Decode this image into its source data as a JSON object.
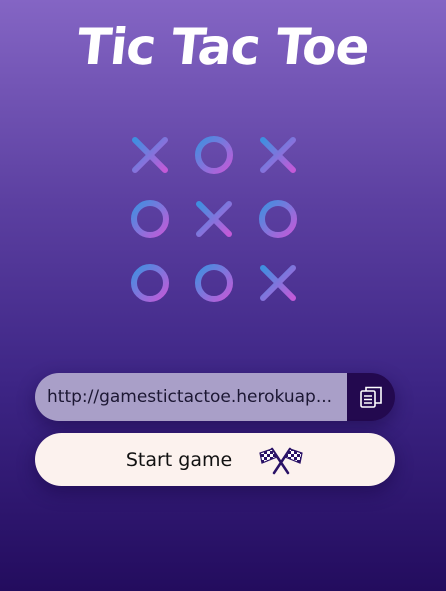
{
  "app": {
    "title": "Tic Tac Toe"
  },
  "logo": {
    "icon": "tic-tac-toe-board-icon",
    "cells": [
      "X",
      "O",
      "X",
      "O",
      "X",
      "O",
      "O",
      "O",
      "X"
    ]
  },
  "share": {
    "url": "http://gamestictactoe.herokuapp.com/...",
    "url_display": "http://gamestictactoe.herokuap...",
    "copy_icon": "copy-icon"
  },
  "actions": {
    "start_label": "Start game",
    "start_icon": "checkered-flags-icon"
  },
  "colors": {
    "background_top": "#8465c4",
    "background_bottom": "#230c5e",
    "url_field_bg": "#a99fc8",
    "copy_button_bg": "#23094f",
    "start_button_bg": "#fcf2ee",
    "logo_gradient_start": "#3f8fe0",
    "logo_gradient_end": "#c35ad8"
  }
}
